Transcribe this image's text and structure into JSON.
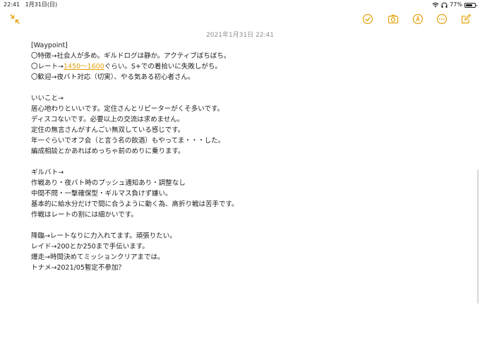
{
  "status_bar": {
    "time": "22:41",
    "date": "1月31日(日)",
    "battery": "77%",
    "battery_level": 0.77
  },
  "toolbar": {
    "collapse_icon": "collapse-arrows-icon",
    "checklist_icon": "checklist-icon",
    "camera_icon": "camera-icon",
    "markup_icon": "pen-markup-icon",
    "more_icon": "ellipsis-icon",
    "compose_icon": "compose-icon",
    "accent_color": "#e3a20b"
  },
  "note": {
    "timestamp": "2021年1月31日 22:41",
    "lines": [
      {
        "text": "[Waypoint]"
      },
      {
        "text": "〇特徴→社会人が多め。ギルドログは静か。アクティブぼちぼち。"
      },
      {
        "pre": "〇レート→",
        "link": "1450～1600",
        "post": "ぐらい。S+での着拾いに失敗しがち。"
      },
      {
        "text": "〇歓迎→夜バト対応（切実）、やる気ある初心者さん。"
      },
      {
        "text": ""
      },
      {
        "text": "いいこと→"
      },
      {
        "text": "居心地わりといいです。定住さんとリピーターがくそ多いです。"
      },
      {
        "text": "ディスコないです。必要以上の交流は求めません。"
      },
      {
        "text": "定住の無言さんがすんごい無双している感じです。"
      },
      {
        "text": "年一ぐらいでオフ会（と言う名の飲酒）もやってま・・・した。"
      },
      {
        "text": "編成相談とかあればめっちゃ前のめりに乗ります。"
      },
      {
        "text": ""
      },
      {
        "text": "ギルバト→"
      },
      {
        "text": "作戦あり・夜バト時のプッシュ通知あり・調整なし"
      },
      {
        "text": "中間不問・一撃確保型・ギルマス負けず嫌い。"
      },
      {
        "text": "基本的に給水分だけで間に合うように動く為、高折り戦は苦手です。"
      },
      {
        "text": "作戦はレートの割には細かいです。"
      },
      {
        "text": ""
      },
      {
        "text": "降臨→レートなりに力入れてます。頑張りたい。"
      },
      {
        "text": "レイド→200とか250まで手伝います。"
      },
      {
        "text": "爆走→時間決めてミッションクリアまでは。"
      },
      {
        "text": "トナメ→2021/05暫定不参加？"
      }
    ]
  }
}
